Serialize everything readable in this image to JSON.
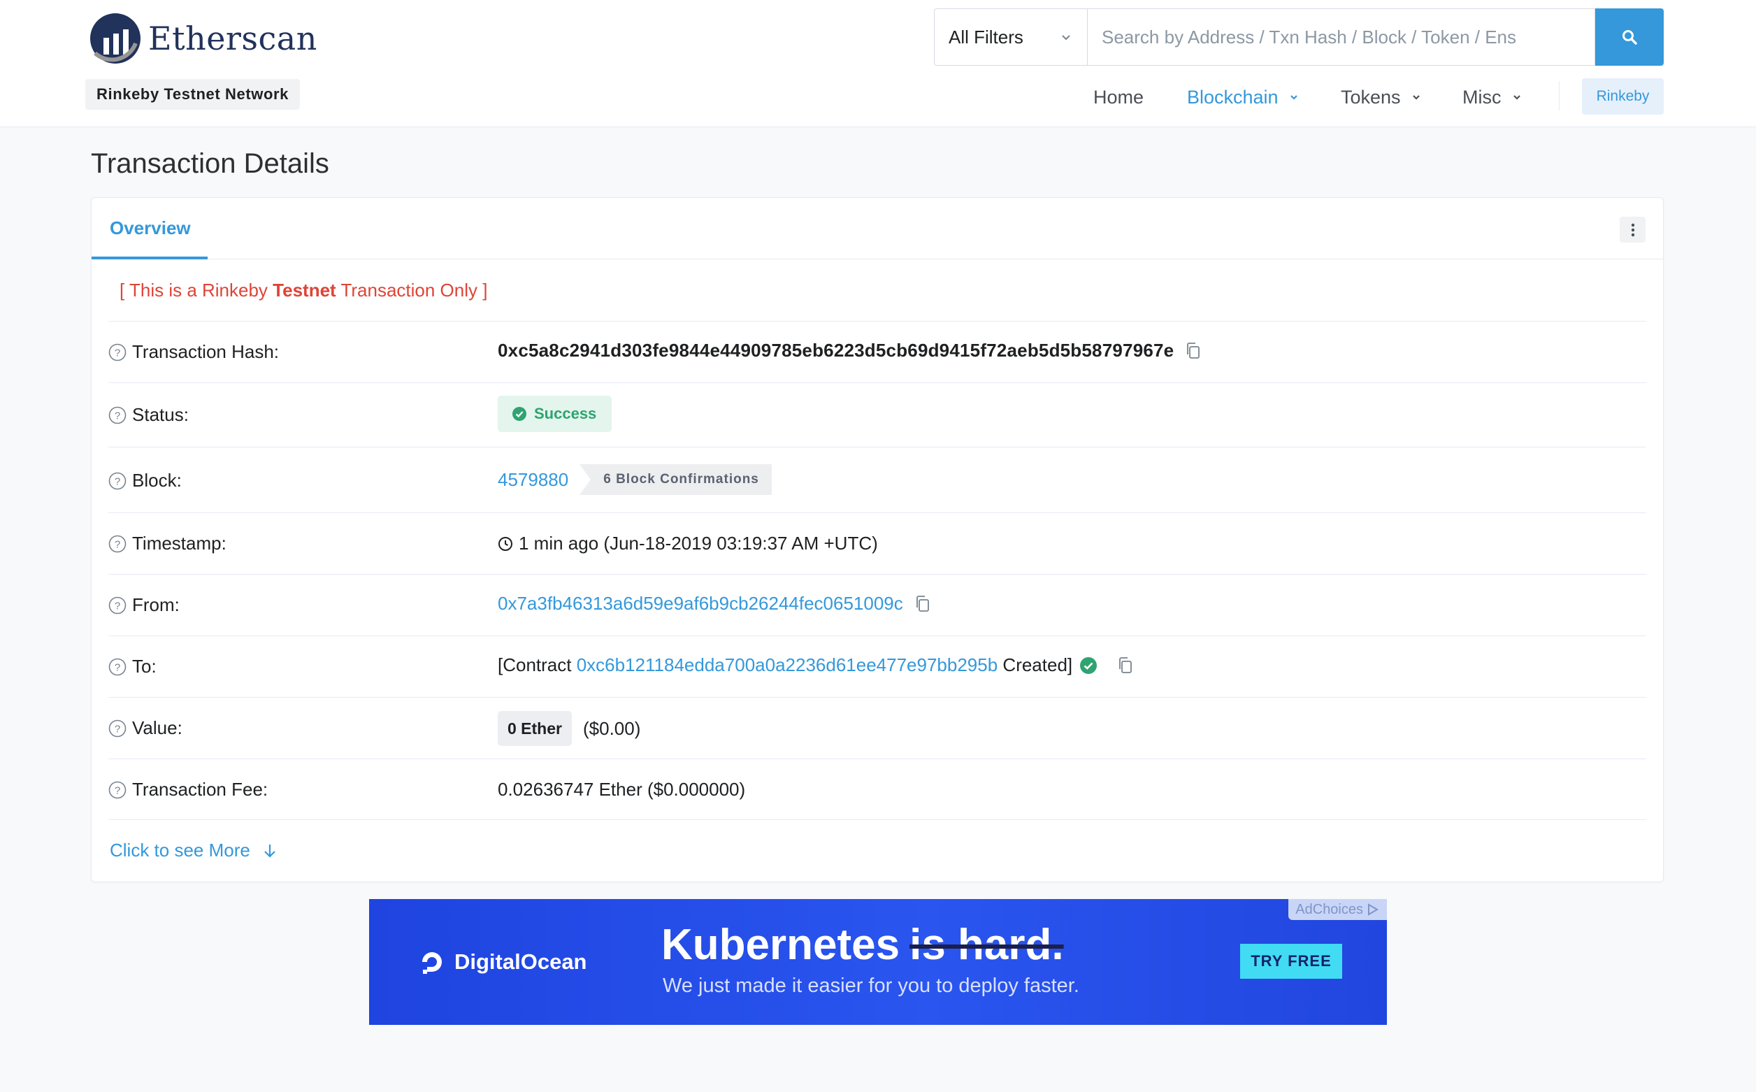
{
  "header": {
    "logo_text": "Etherscan",
    "network_badge": "Rinkeby Testnet Network",
    "search": {
      "filter_label": "All Filters",
      "placeholder": "Search by Address / Txn Hash / Block / Token / Ens"
    },
    "nav": {
      "home": "Home",
      "blockchain": "Blockchain",
      "tokens": "Tokens",
      "misc": "Misc",
      "network": "Rinkeby"
    }
  },
  "page": {
    "title": "Transaction Details"
  },
  "card": {
    "tab_overview": "Overview",
    "notice_prefix": "[ This is a Rinkeby ",
    "notice_bold": "Testnet",
    "notice_suffix": " Transaction Only ]",
    "rows": {
      "hash": {
        "label": "Transaction Hash:",
        "value": "0xc5a8c2941d303fe9844e44909785eb6223d5cb69d9415f72aeb5d5b58797967e"
      },
      "status": {
        "label": "Status:",
        "value": "Success"
      },
      "block": {
        "label": "Block:",
        "value": "4579880",
        "confirmations": "6 Block Confirmations"
      },
      "timestamp": {
        "label": "Timestamp:",
        "value": "1 min ago (Jun-18-2019 03:19:37 AM +UTC)"
      },
      "from": {
        "label": "From:",
        "value": "0x7a3fb46313a6d59e9af6b9cb26244fec0651009c"
      },
      "to": {
        "label": "To:",
        "prefix": "[Contract ",
        "address": "0xc6b121184edda700a0a2236d61ee477e97bb295b",
        "suffix": " Created]"
      },
      "value": {
        "label": "Value:",
        "amount": "0 Ether",
        "usd": "($0.00)"
      },
      "fee": {
        "label": "Transaction Fee:",
        "value": "0.02636747 Ether ($0.000000)"
      }
    },
    "see_more": "Click to see More"
  },
  "ad": {
    "ad_choices": "AdChoices",
    "brand": "DigitalOcean",
    "headline_main": "Kubernetes",
    "headline_strike": "is hard.",
    "subline": "We just made it easier for you to deploy faster.",
    "cta": "TRY FREE"
  },
  "colors": {
    "accent": "#3498db",
    "notice_red": "#de4437",
    "success_green": "#2fa370"
  }
}
